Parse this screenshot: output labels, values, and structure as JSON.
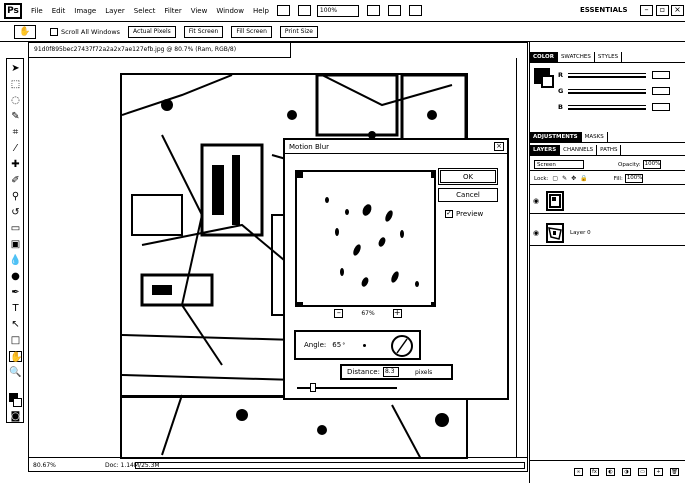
{
  "app": {
    "logo": "Ps",
    "menu": [
      "File",
      "Edit",
      "Image",
      "Layer",
      "Select",
      "Filter",
      "View",
      "Window",
      "Help"
    ],
    "zoom_select": "100%",
    "workspace": "ESSENTIALS"
  },
  "options_bar": {
    "tool_icon": "hand-tool-icon",
    "scroll_all_windows": "Scroll All Windows",
    "buttons": [
      "Actual Pixels",
      "Fit Screen",
      "Fill Screen",
      "Print Size"
    ]
  },
  "document": {
    "tab_title": "91d0f895bec27437f72a2a2x7ae127efb.jpg @ 80.7% (Ram, RGB/8)",
    "zoom": "80.67%",
    "doc_size": "Doc: 1.14M/25.3M"
  },
  "dialog": {
    "title": "Motion Blur",
    "ok": "OK",
    "cancel": "Cancel",
    "preview_label": "Preview",
    "preview_checked": true,
    "preview_zoom": "67%",
    "angle_label": "Angle:",
    "angle_value": "65",
    "distance_label": "Distance:",
    "distance_value": "8.3",
    "distance_unit": "pixels"
  },
  "panels": {
    "color_tabs": [
      "COLOR",
      "SWATCHES",
      "STYLES"
    ],
    "rgb": [
      "R",
      "G",
      "B"
    ],
    "adjust_tabs": [
      "ADJUSTMENTS",
      "MASKS"
    ],
    "layers_tabs": [
      "LAYERS",
      "CHANNELS",
      "PATHS"
    ],
    "blend_mode": "Screen",
    "opacity_label": "Opacity:",
    "opacity_value": "100%",
    "lock_label": "Lock:",
    "fill_label": "Fill:",
    "fill_value": "100%",
    "layers": [
      {
        "name": ""
      },
      {
        "name": "Layer 0"
      }
    ]
  }
}
